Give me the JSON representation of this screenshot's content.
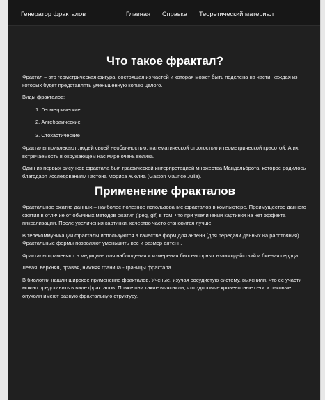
{
  "navbar": {
    "brand": "Генератор фракталов",
    "links": [
      "Главная",
      "Справка",
      "Теоретический материал"
    ]
  },
  "section1": {
    "title": "Что такое фрактал?",
    "intro": "Фрактал – это геометрическая фигура, состоящая из частей и которая может быть поделена на части, каждая из которых будет представлять уменьшенную копию целого.",
    "types_label": "Виды фракталов:",
    "types": [
      "1. Геометрические",
      "2. Алгебраические",
      "3. Стохастические"
    ],
    "p2": "Фракталы привлекают людей своей необычностью, математической строгостью и геометрической красотой. А их встречаемость в окружающем нас мире очень велика.",
    "p3": "Один из первых рисунков фрактала был графической интерпретацией множества Мандельброта, которое родилось благодаря исследованиям Гастона Мориса Жюлиа (Gaston Maurice Julia)."
  },
  "section2": {
    "title": "Применение фракталов",
    "p1": "Фрактальное сжатие данных – наиболее полезное использование фракталов в компьютере. Преимущество данного сжатия в отличие от обычных методов сжатия (jpeg, gif) в том, что при увеличении картинки на нет эффекта пикселизации. После увеличения картинки, качество часто становится лучше.",
    "p2": "В телекоммуникации фракталы используются в качестве форм для антенн (для передачи данных на расстояния). Фрактальные формы позволяют уменьшить вес и размер антенн.",
    "p3": "Фракталы применяют в медицине для наблюдения и измерения биосенсорных взаимодействий и биения сердца.",
    "p4": "Левая, верхняя, правая, нижняя граница - границы фрактала",
    "p5": "В биологии нашли широкое применение фракталов. Ученые, изучая сосудистую систему, выяснили, что ее участи можно представить в виде фракталов. Позже они также выяснили, что здоровые кровеносные сети и раковые опухоли имеют разную фрактальную структуру."
  }
}
